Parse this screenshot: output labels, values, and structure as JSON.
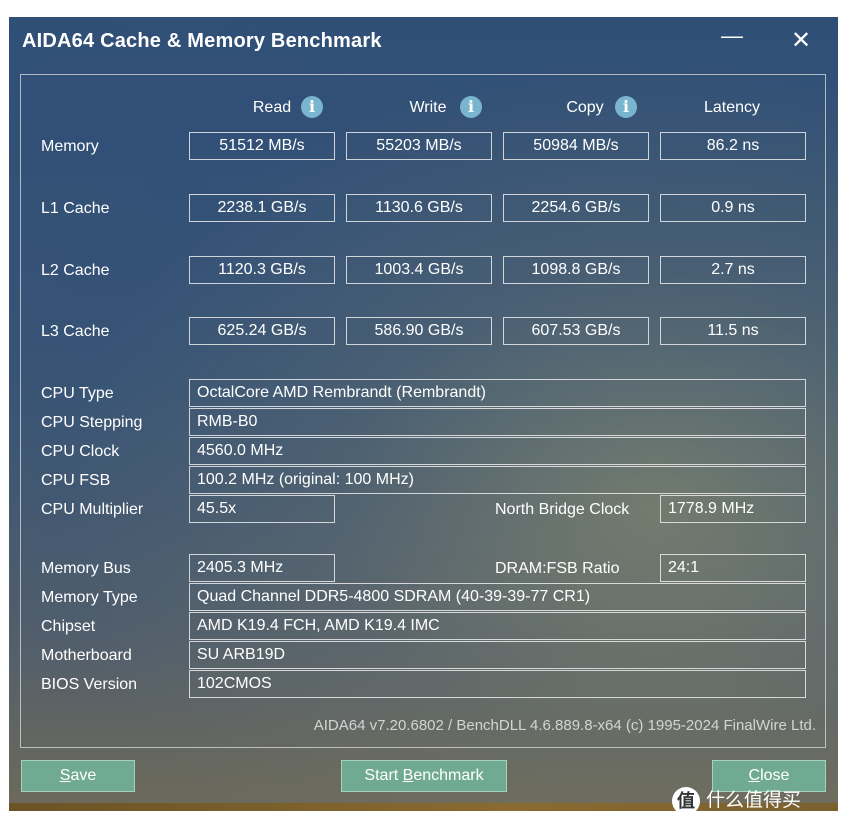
{
  "window": {
    "title": "AIDA64 Cache & Memory Benchmark",
    "minimize_glyph": "—",
    "close_glyph": "✕"
  },
  "columns": {
    "read": "Read",
    "write": "Write",
    "copy": "Copy",
    "latency": "Latency"
  },
  "info_glyph": "i",
  "rows": [
    {
      "label": "Memory",
      "read": "51512 MB/s",
      "write": "55203 MB/s",
      "copy": "50984 MB/s",
      "latency": "86.2 ns"
    },
    {
      "label": "L1 Cache",
      "read": "2238.1 GB/s",
      "write": "1130.6 GB/s",
      "copy": "2254.6 GB/s",
      "latency": "0.9 ns"
    },
    {
      "label": "L2 Cache",
      "read": "1120.3 GB/s",
      "write": "1003.4 GB/s",
      "copy": "1098.8 GB/s",
      "latency": "2.7 ns"
    },
    {
      "label": "L3 Cache",
      "read": "625.24 GB/s",
      "write": "586.90 GB/s",
      "copy": "607.53 GB/s",
      "latency": "11.5 ns"
    }
  ],
  "cpu": {
    "type_label": "CPU Type",
    "type": "OctalCore AMD Rembrandt  (Rembrandt)",
    "stepping_label": "CPU Stepping",
    "stepping": "RMB-B0",
    "clock_label": "CPU Clock",
    "clock": "4560.0 MHz",
    "fsb_label": "CPU FSB",
    "fsb": "100.2 MHz  (original: 100 MHz)",
    "multiplier_label": "CPU Multiplier",
    "multiplier": "45.5x",
    "nb_clock_label": "North Bridge Clock",
    "nb_clock": "1778.9 MHz"
  },
  "memory": {
    "bus_label": "Memory Bus",
    "bus": "2405.3 MHz",
    "ratio_label": "DRAM:FSB Ratio",
    "ratio": "24:1",
    "type_label": "Memory Type",
    "type": "Quad Channel DDR5-4800 SDRAM  (40-39-39-77 CR1)",
    "chipset_label": "Chipset",
    "chipset": "AMD K19.4 FCH, AMD K19.4 IMC",
    "motherboard_label": "Motherboard",
    "motherboard": "SU ARB19D",
    "bios_label": "BIOS Version",
    "bios": "102CMOS"
  },
  "credit": "AIDA64 v7.20.6802 / BenchDLL 4.6.889.8-x64  (c) 1995-2024 FinalWire Ltd.",
  "buttons": {
    "save_first": "S",
    "save_rest": "ave",
    "start_pre": "Start ",
    "start_u": "B",
    "start_rest": "enchmark",
    "close_first": "C",
    "close_rest": "lose"
  },
  "watermark": {
    "logo": "值",
    "text": "什么值得买"
  }
}
